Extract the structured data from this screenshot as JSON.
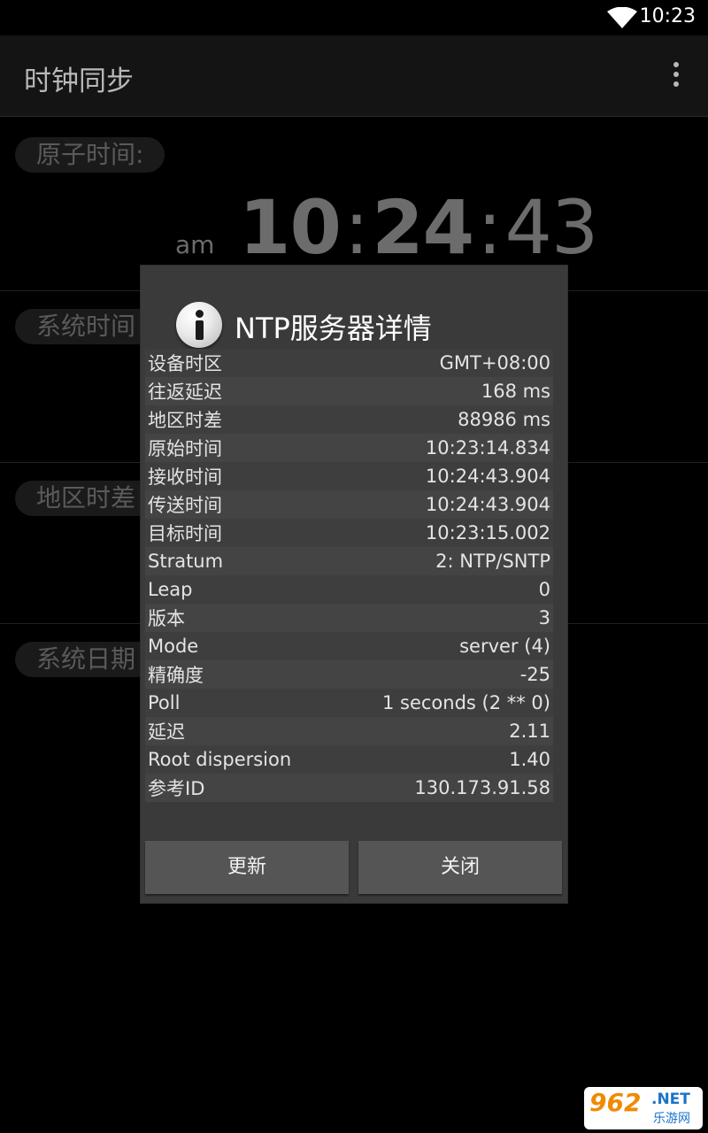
{
  "status_bar": {
    "time": "10:23"
  },
  "app": {
    "title": "时钟同步"
  },
  "background": {
    "atomic_label": "原子时间:",
    "system_time_label": "系统时间",
    "region_diff_label": "地区时差",
    "system_date_label": "系统日期",
    "time_hh": "10",
    "time_mm": "24",
    "time_ss": "43",
    "ampm": "am",
    "sep": ":"
  },
  "dialog": {
    "title": "NTP服务器详情",
    "rows": [
      {
        "label": "设备时区",
        "value": "GMT+08:00"
      },
      {
        "label": "往返延迟",
        "value": "168 ms"
      },
      {
        "label": "地区时差",
        "value": "88986 ms"
      },
      {
        "label": "原始时间",
        "value": "10:23:14.834"
      },
      {
        "label": "接收时间",
        "value": "10:24:43.904"
      },
      {
        "label": "传送时间",
        "value": "10:24:43.904"
      },
      {
        "label": "目标时间",
        "value": "10:23:15.002"
      },
      {
        "label": "Stratum",
        "value": "2: NTP/SNTP"
      },
      {
        "label": "Leap",
        "value": "0"
      },
      {
        "label": "版本",
        "value": "3"
      },
      {
        "label": "Mode",
        "value": "server (4)"
      },
      {
        "label": "精确度",
        "value": "-25"
      },
      {
        "label": "Poll",
        "value": "1 seconds (2 ** 0)"
      },
      {
        "label": "延迟",
        "value": "2.11"
      },
      {
        "label": "Root dispersion",
        "value": "1.40"
      },
      {
        "label": "参考ID",
        "value": "130.173.91.58"
      }
    ],
    "update_label": "更新",
    "close_label": "关闭"
  },
  "watermark": {
    "num": "962",
    "net": ".NET",
    "cn": "乐游网"
  }
}
